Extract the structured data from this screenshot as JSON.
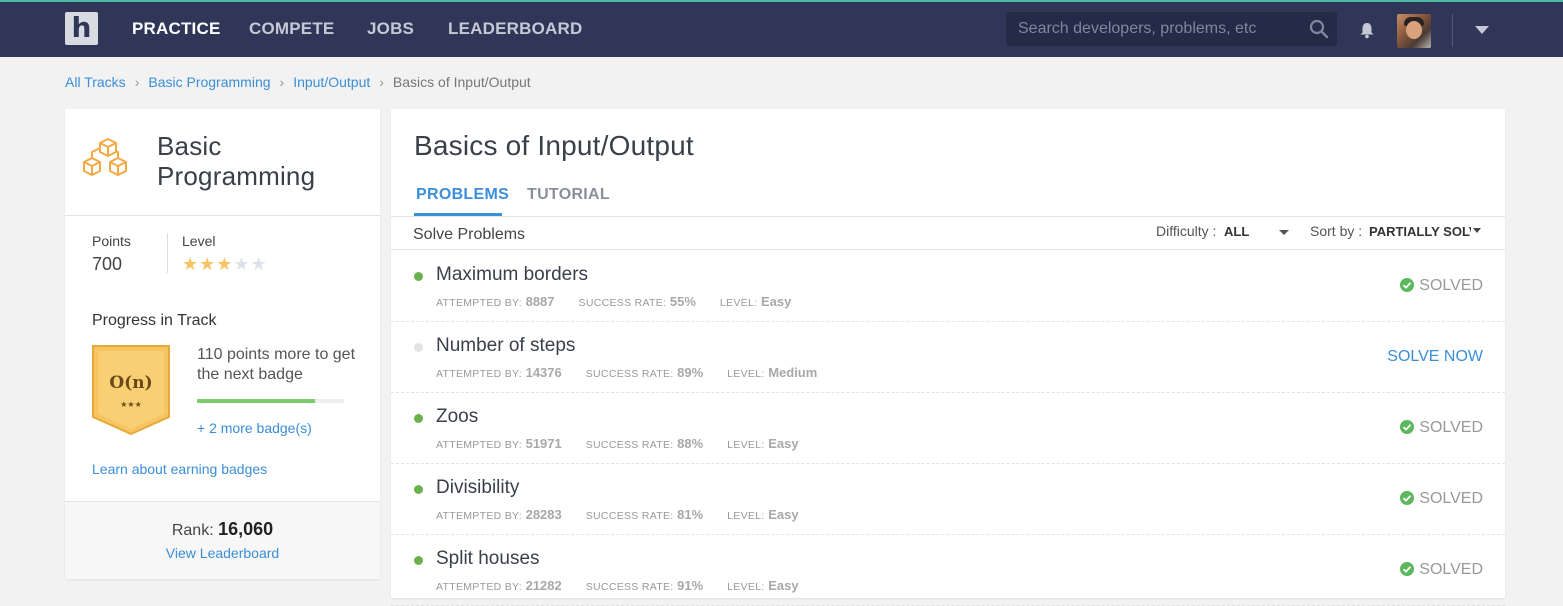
{
  "nav": {
    "logo": "h",
    "items": [
      "PRACTICE",
      "COMPETE",
      "JOBS",
      "LEADERBOARD"
    ],
    "active": "PRACTICE",
    "search_placeholder": "Search developers, problems, etc"
  },
  "breadcrumb": [
    "All Tracks",
    "Basic Programming",
    "Input/Output",
    "Basics of Input/Output"
  ],
  "track": {
    "title": "Basic Programming",
    "points_label": "Points",
    "points": "700",
    "level_label": "Level",
    "level_stars": 3,
    "level_max": 5,
    "progress_title": "Progress in Track",
    "badge_text": "O(n)",
    "badge_stars": "★★★",
    "next_badge_text": "110 points more to get the next badge",
    "progress_fraction": 0.8,
    "more_badges": "+ 2 more badge(s)",
    "learn_link": "Learn about earning badges",
    "rank_label": "Rank:",
    "rank": "16,060",
    "view_leaderboard": "View Leaderboard"
  },
  "main": {
    "title": "Basics of Input/Output",
    "tabs": [
      "PROBLEMS",
      "TUTORIAL"
    ],
    "solve_title": "Solve Problems",
    "difficulty_label": "Difficulty :",
    "difficulty_value": "ALL",
    "sort_label": "Sort by :",
    "sort_value": "PARTIALLY SOLVED",
    "meta_labels": {
      "attempted": "ATTEMPTED BY:",
      "success": "SUCCESS RATE:",
      "level": "LEVEL:"
    },
    "problems": [
      {
        "name": "Maximum borders",
        "attempted": "8887",
        "success": "55%",
        "level": "Easy",
        "status": "SOLVED",
        "solved": true
      },
      {
        "name": "Number of steps",
        "attempted": "14376",
        "success": "89%",
        "level": "Medium",
        "status": "SOLVE NOW",
        "solved": false
      },
      {
        "name": "Zoos",
        "attempted": "51971",
        "success": "88%",
        "level": "Easy",
        "status": "SOLVED",
        "solved": true
      },
      {
        "name": "Divisibility",
        "attempted": "28283",
        "success": "81%",
        "level": "Easy",
        "status": "SOLVED",
        "solved": true
      },
      {
        "name": "Split houses",
        "attempted": "21282",
        "success": "91%",
        "level": "Easy",
        "status": "SOLVED",
        "solved": true
      }
    ]
  },
  "colors": {
    "nav_bg": "#2f3657",
    "accent": "#3b8ed8",
    "solved_green": "#5cb85c",
    "badge_gold": "#f6c462"
  }
}
